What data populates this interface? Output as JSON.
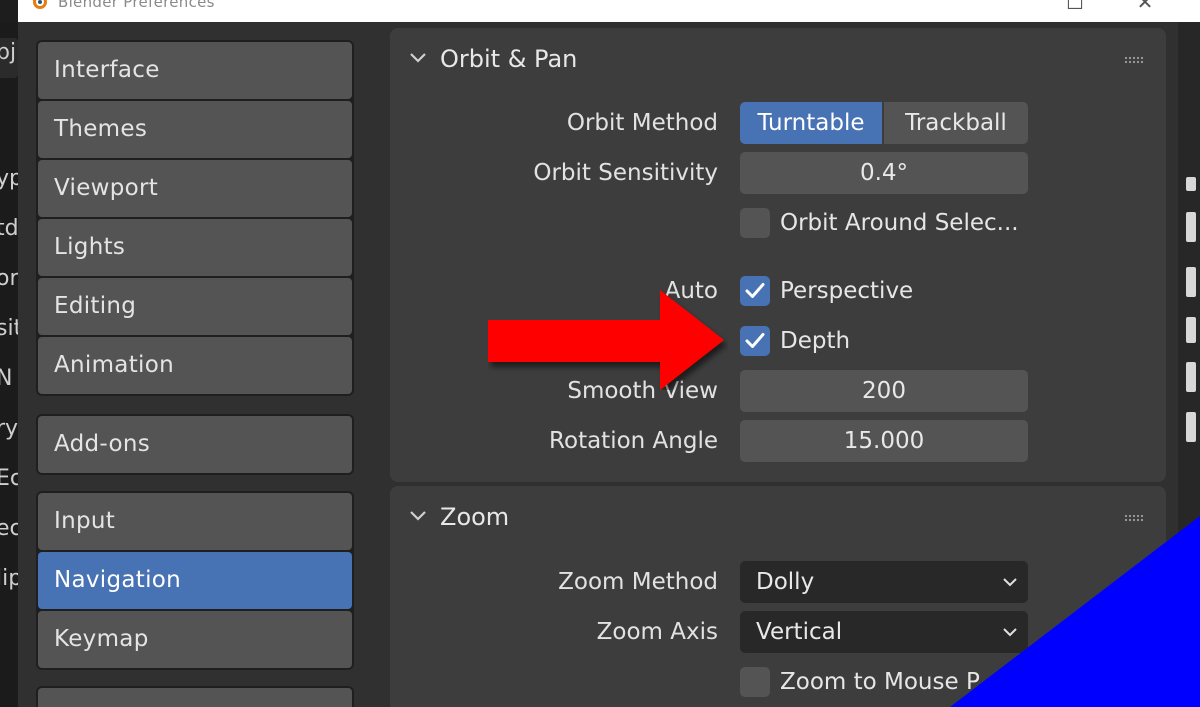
{
  "window": {
    "title": "Blender Preferences",
    "maximize_glyph": "☐",
    "close_glyph": "✕"
  },
  "background_fragments": [
    "pj",
    "yp",
    "td",
    "or",
    "sit",
    "N",
    "ry",
    "Ec",
    "ec",
    "lip"
  ],
  "sidebar": {
    "groups": [
      [
        "Interface",
        "Themes",
        "Viewport",
        "Lights",
        "Editing",
        "Animation"
      ],
      [
        "Add-ons"
      ],
      [
        "Input",
        "Navigation",
        "Keymap"
      ]
    ],
    "active": "Navigation"
  },
  "orbit_pan": {
    "title": "Orbit & Pan",
    "orbit_method_label": "Orbit Method",
    "orbit_method_options": [
      "Turntable",
      "Trackball"
    ],
    "orbit_method_selected": "Turntable",
    "orbit_sensitivity_label": "Orbit Sensitivity",
    "orbit_sensitivity_value": "0.4°",
    "orbit_around_selection_label": "Orbit Around Selec...",
    "orbit_around_selection_checked": false,
    "auto_label": "Auto",
    "perspective_label": "Perspective",
    "perspective_checked": true,
    "depth_label": "Depth",
    "depth_checked": true,
    "smooth_view_label": "Smooth View",
    "smooth_view_value": "200",
    "rotation_angle_label": "Rotation Angle",
    "rotation_angle_value": "15.000"
  },
  "zoom": {
    "title": "Zoom",
    "zoom_method_label": "Zoom Method",
    "zoom_method_value": "Dolly",
    "zoom_axis_label": "Zoom Axis",
    "zoom_axis_value": "Vertical",
    "zoom_to_mouse_label": "Zoom to Mouse P",
    "zoom_to_mouse_checked": false
  },
  "colors": {
    "accent": "#4772b3",
    "annotation_arrow": "#ff0000",
    "corner_overlay": "#0000ff"
  }
}
